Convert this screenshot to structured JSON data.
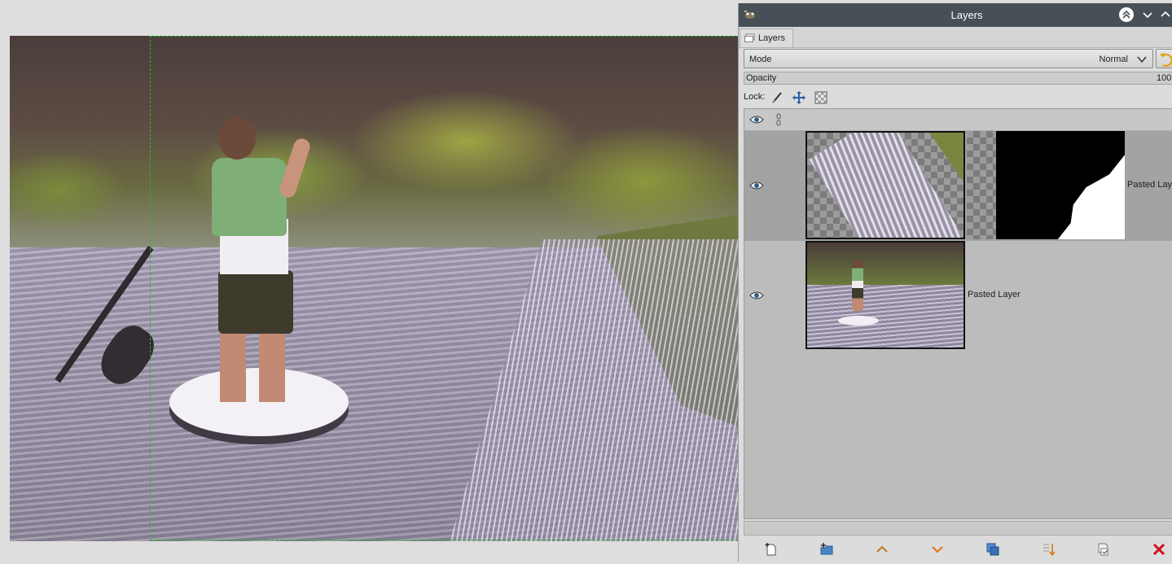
{
  "dock": {
    "title": "Layers",
    "tab_label": "Layers",
    "mode_label": "Mode",
    "mode_value": "Normal",
    "opacity_label": "Opacity",
    "opacity_value": "100.",
    "lock_label": "Lock:"
  },
  "layers": [
    {
      "name": "Pasted Laye",
      "visible": true,
      "has_mask": true,
      "selected": true
    },
    {
      "name": "Pasted Layer",
      "visible": true,
      "has_mask": false,
      "selected": false
    }
  ],
  "bottom_buttons": [
    "new-layer-icon",
    "new-layer-group-icon",
    "raise-layer-icon",
    "lower-layer-icon",
    "duplicate-layer-icon",
    "anchor-layer-icon",
    "merge-layer-icon",
    "delete-layer-icon"
  ],
  "colors": {
    "titlebar": "#475057",
    "selection_border": "#1fc21f",
    "raise_arrow": "#c0761f",
    "lower_arrow": "#e0781a",
    "delete": "#d0121a"
  }
}
